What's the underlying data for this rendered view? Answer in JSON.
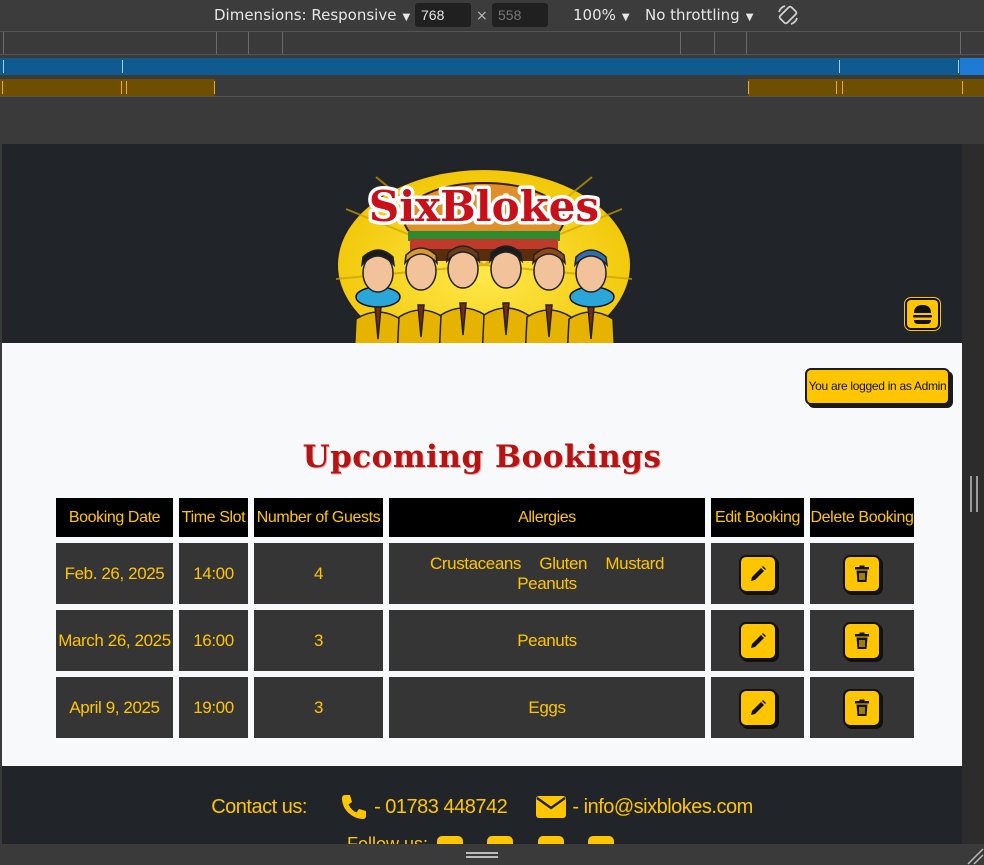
{
  "devtools": {
    "dimensions_label": "Dimensions: Responsive",
    "width_value": "768",
    "height_placeholder": "558",
    "times_sign": "×",
    "zoom_label": "100%",
    "throttling_label": "No throttling",
    "caret": "▼"
  },
  "header": {
    "logo_text": "SixBlokes",
    "toggle_icon": "burger-icon"
  },
  "main": {
    "login_status": "You are logged in as Admin",
    "title": "Upcoming Bookings",
    "table": {
      "headers": [
        "Booking Date",
        "Time Slot",
        "Number of Guests",
        "Allergies",
        "Edit Booking",
        "Delete Booking"
      ],
      "rows": [
        {
          "date": "Feb. 26, 2025",
          "time": "14:00",
          "guests": "4",
          "allergies": [
            "Crustaceans",
            "Gluten",
            "Mustard",
            "Peanuts"
          ]
        },
        {
          "date": "March 26, 2025",
          "time": "16:00",
          "guests": "3",
          "allergies": [
            "Peanuts"
          ]
        },
        {
          "date": "April 9, 2025",
          "time": "19:00",
          "guests": "3",
          "allergies": [
            "Eggs"
          ]
        }
      ]
    }
  },
  "footer": {
    "contact_label": "Contact us:",
    "phone": "- 01783 448742",
    "email": "- info@sixblokes.com",
    "follow_label": "Follow us:"
  },
  "colors": {
    "accent": "#ffc600",
    "dark": "#212529",
    "title_red": "#b51414",
    "cell_bg": "#353535"
  }
}
